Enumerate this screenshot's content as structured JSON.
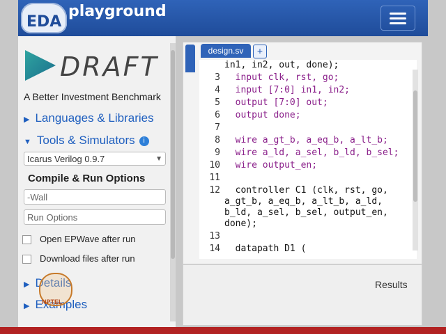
{
  "header": {
    "logo_text": "EDA",
    "brand": "playground",
    "menu_icon": "hamburger-icon",
    "accent_color": "#2f63b8"
  },
  "sidebar": {
    "logo_word": "DRAFT",
    "tagline": "A Better Investment Benchmark",
    "nav": [
      {
        "label": "Languages & Libraries"
      },
      {
        "label": "Tools & Simulators"
      },
      {
        "label": "Details"
      },
      {
        "label": "Examples"
      }
    ],
    "simulator_select": "Icarus Verilog 0.9.7",
    "compile_title": "Compile & Run Options",
    "compile_options_value": "-Wall",
    "run_options_placeholder": "Run Options",
    "open_epwave": "Open EPWave after run",
    "download_files": "Download files after run",
    "watermark": "NPTEL"
  },
  "editor": {
    "tab_label": "design.sv",
    "add_tab": "+",
    "lines": [
      {
        "n": "",
        "text": "in1, in2, out, done);"
      },
      {
        "n": "3",
        "text": "  input clk, rst, go;"
      },
      {
        "n": "4",
        "text": "  input [7:0] in1, in2;"
      },
      {
        "n": "5",
        "text": "  output [7:0] out;"
      },
      {
        "n": "6",
        "text": "  output done;"
      },
      {
        "n": "7",
        "text": ""
      },
      {
        "n": "8",
        "text": "  wire a_gt_b, a_eq_b, a_lt_b;"
      },
      {
        "n": "9",
        "text": "  wire a_ld, a_sel, b_ld, b_sel;"
      },
      {
        "n": "10",
        "text": "  wire output_en;"
      },
      {
        "n": "11",
        "text": ""
      },
      {
        "n": "12",
        "text": "  controller C1 (clk, rst, go,"
      },
      {
        "n": "",
        "text": "a_gt_b, a_eq_b, a_lt_b, a_ld,"
      },
      {
        "n": "",
        "text": "b_ld, a_sel, b_sel, output_en,"
      },
      {
        "n": "",
        "text": "done);"
      },
      {
        "n": "13",
        "text": ""
      },
      {
        "n": "14",
        "text": "  datapath D1 ("
      }
    ]
  },
  "results": {
    "label": "Results"
  }
}
